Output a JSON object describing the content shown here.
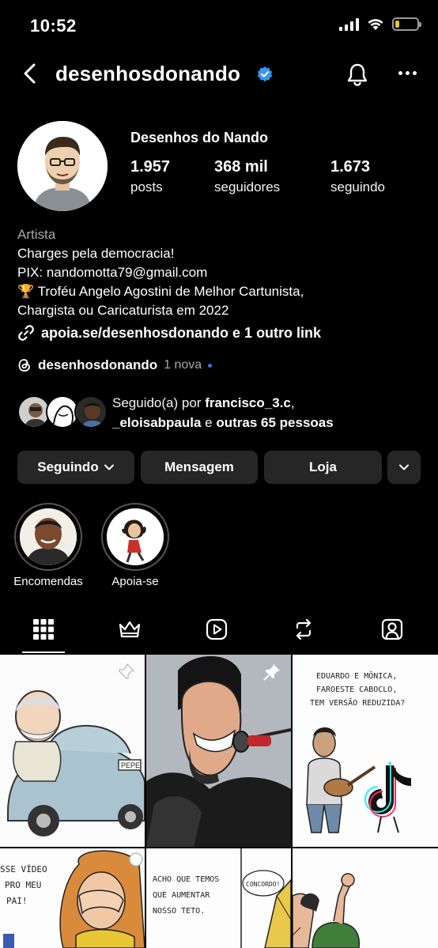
{
  "status_bar": {
    "time": "10:52"
  },
  "header": {
    "username": "desenhosdonando"
  },
  "profile": {
    "display_name": "Desenhos do Nando",
    "stats": [
      {
        "value": "1.957",
        "label": "posts"
      },
      {
        "value": "368 mil",
        "label": "seguidores"
      },
      {
        "value": "1.673",
        "label": "seguindo"
      }
    ],
    "category": "Artista",
    "bio_lines": [
      "Charges pela democracia!",
      "PIX: nandomotta79@gmail.com",
      "🏆 Troféu Angelo Agostini de Melhor Cartunista,",
      "Chargista ou Caricaturista em 2022"
    ],
    "link_text": "apoia.se/desenhosdonando e 1 outro link",
    "threads": {
      "handle": "desenhosdonando",
      "badge": "1 nova"
    },
    "followed_by": {
      "prefix": "Seguido(a) por ",
      "user1": "francisco_3.c",
      "comma": ",",
      "user2": "_eloisabpaula",
      "joiner": " e ",
      "others": "outras 65 pessoas"
    }
  },
  "buttons": {
    "following": "Seguindo",
    "message": "Mensagem",
    "shop": "Loja"
  },
  "highlights": [
    {
      "label": "Encomendas"
    },
    {
      "label": "Apoia-se"
    }
  ],
  "tabs": [
    "grid-icon",
    "crown-icon",
    "reels-icon",
    "reposts-icon",
    "tagged-icon"
  ],
  "posts": {
    "post3_text": [
      "EDUARDO E MÔNICA,",
      "FAROESTE CABOCLO,",
      "TEM VERSÃO REDUZIDA?"
    ],
    "post1_plate": "PEPE",
    "post4_text": [
      "SSE VÍDEO",
      "PRO MEU",
      "PAI!"
    ],
    "post5_text": [
      "ACHO QUE TEMOS",
      "QUE AUMENTAR",
      "NOSSO TETO."
    ],
    "post5_bubble": "CONCORDO!"
  },
  "colors": {
    "background": "#000000",
    "button": "#262626",
    "verified": "#3897f0",
    "muted": "#a8a8a8"
  }
}
